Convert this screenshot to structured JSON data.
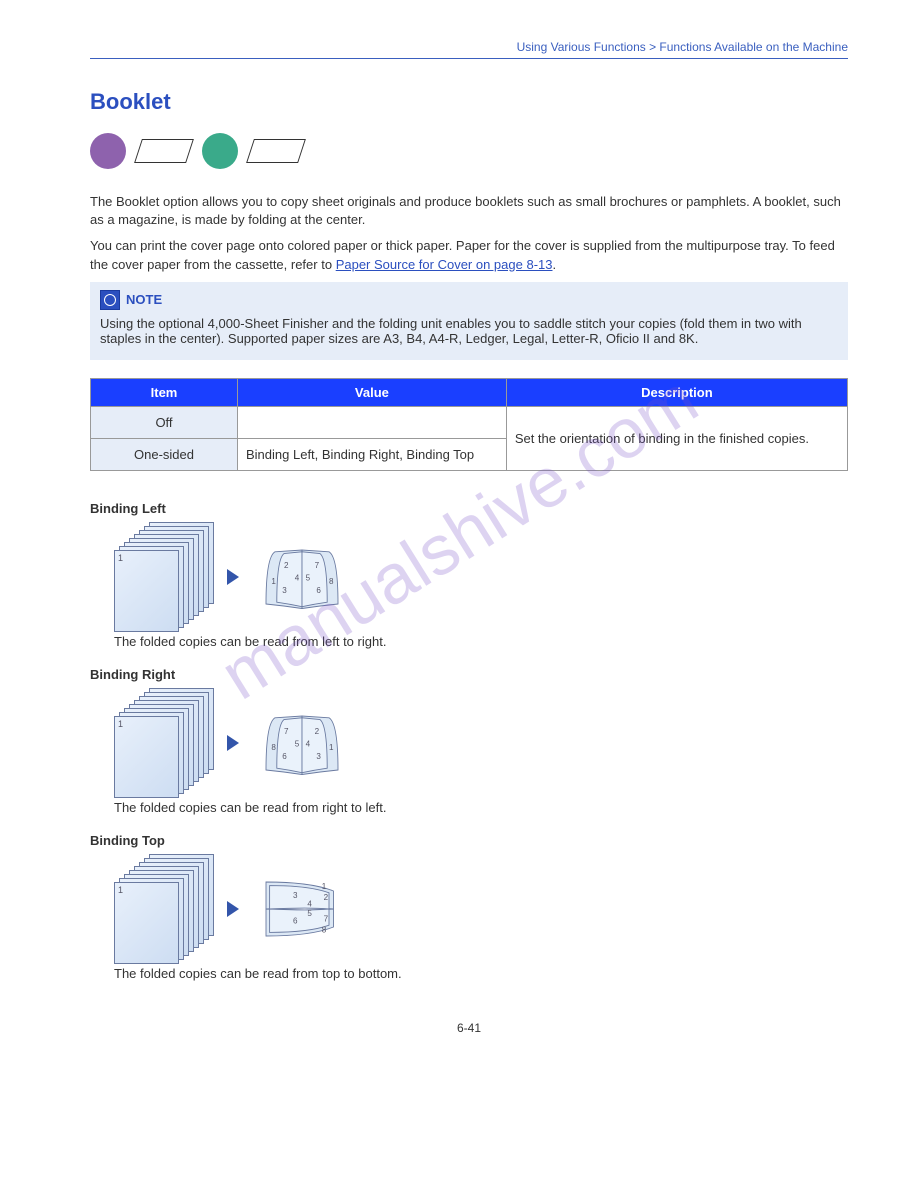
{
  "header": {
    "breadcrumb": "Using Various Functions > Functions Available on the Machine"
  },
  "section": {
    "title": "Booklet"
  },
  "intro": {
    "p1": "The Booklet option allows you to copy sheet originals and produce booklets such as small brochures or pamphlets. A booklet, such as a magazine, is made by folding at the center.",
    "p2a": "You can print the cover page onto colored paper or thick paper. Paper for the cover is supplied from the multipurpose tray. To feed the cover paper from the cassette, refer to ",
    "link": "Paper Source for Cover on page 8-13",
    "p2b": "."
  },
  "note": {
    "label": "NOTE",
    "body": "Using the optional 4,000-Sheet Finisher and the folding unit enables you to saddle stitch your copies (fold them in two with staples in the center). Supported paper sizes are A3, B4, A4-R, Ledger, Legal, Letter-R, Oficio II and 8K."
  },
  "table": {
    "h1": "Item",
    "h2": "Value",
    "h3": "Description",
    "r1c1": "Off",
    "r1c2": "",
    "r2c1": "One-sided",
    "r2c2": "Binding Left, Binding Right, Binding Top",
    "desc": "Set the orientation of binding in the finished copies."
  },
  "sub1": {
    "head": "Binding Left",
    "cap": "The folded copies can be read from left to right."
  },
  "sub2": {
    "head": "Binding Right",
    "cap": "The folded copies can be read from right to left."
  },
  "sub3": {
    "head": "Binding Top",
    "cap": "The folded copies can be read from top to bottom."
  },
  "sheets": [
    "1",
    "2",
    "3",
    "4",
    "5",
    "6",
    "7",
    "8"
  ],
  "pagenum": "6-41",
  "watermark": "manualshive.com"
}
